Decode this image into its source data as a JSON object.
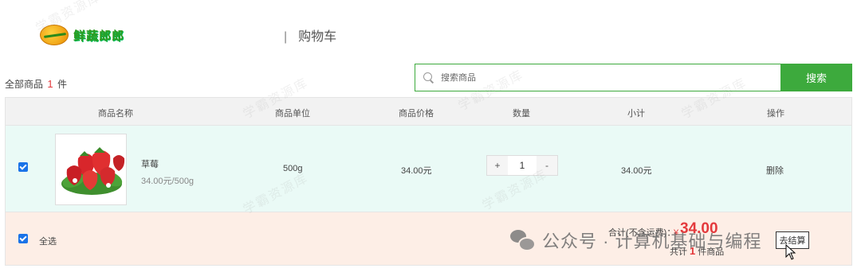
{
  "header": {
    "logo_text": "鲜蔬郎郎",
    "separator": "|",
    "title": "购物车"
  },
  "summary": {
    "prefix": "全部商品",
    "count": "1",
    "suffix": "件"
  },
  "search": {
    "placeholder": "搜索商品",
    "button_label": "搜索"
  },
  "table": {
    "columns": [
      "商品名称",
      "商品单位",
      "商品价格",
      "数量",
      "小计",
      "操作"
    ],
    "rows": [
      {
        "checked": true,
        "name": "草莓",
        "spec": "34.00元/500g",
        "unit": "500g",
        "price": "34.00元",
        "quantity": "1",
        "subtotal": "34.00元",
        "action": "删除"
      }
    ]
  },
  "stepper": {
    "plus": "+",
    "minus": "-"
  },
  "footer": {
    "select_all_label": "全选",
    "total_label": "合计(不含运费)：",
    "currency": "¥",
    "total": "34.00",
    "count_prefix": "共计",
    "count": "1",
    "count_suffix": "件商品",
    "checkout_label": "去结算"
  },
  "watermark": {
    "text": "学霸资源库",
    "wechat": "公众号 · 计算机基础与编程"
  },
  "colors": {
    "accent_green": "#3daa3d",
    "price_red": "#e4393c",
    "row_bg": "#eafaf6",
    "footer_bg": "#fdeee6"
  }
}
